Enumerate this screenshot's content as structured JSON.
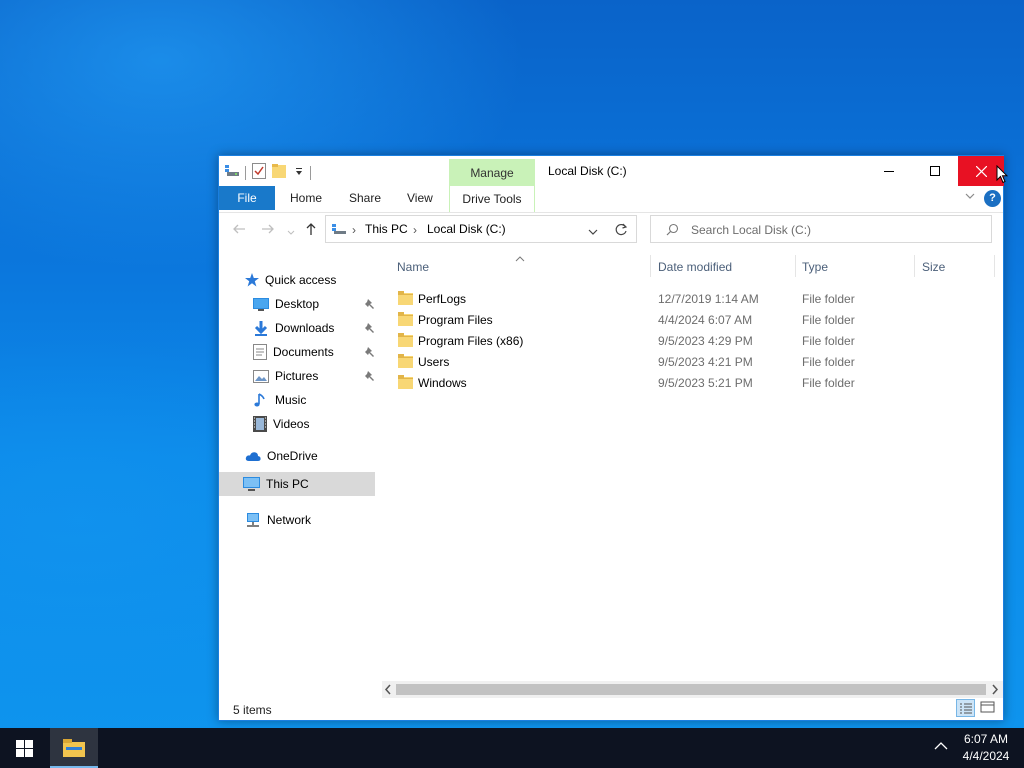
{
  "window": {
    "title": "Local Disk (C:)",
    "contextual_tab_group": "Manage",
    "contextual_tab": "Drive Tools"
  },
  "ribbon": {
    "tabs": [
      "File",
      "Home",
      "Share",
      "View"
    ]
  },
  "address": {
    "crumbs": [
      "This PC",
      "Local Disk (C:)"
    ]
  },
  "search": {
    "placeholder": "Search Local Disk (C:)"
  },
  "sidebar": {
    "quick_access": "Quick access",
    "pinned": [
      {
        "label": "Desktop",
        "icon": "desktop-icon",
        "pinned": true
      },
      {
        "label": "Downloads",
        "icon": "downloads-icon",
        "pinned": true
      },
      {
        "label": "Documents",
        "icon": "documents-icon",
        "pinned": true
      },
      {
        "label": "Pictures",
        "icon": "pictures-icon",
        "pinned": true
      },
      {
        "label": "Music",
        "icon": "music-icon",
        "pinned": false
      },
      {
        "label": "Videos",
        "icon": "videos-icon",
        "pinned": false
      }
    ],
    "onedrive": "OneDrive",
    "this_pc": "This PC",
    "network": "Network"
  },
  "columns": [
    "Name",
    "Date modified",
    "Type",
    "Size"
  ],
  "files": [
    {
      "name": "PerfLogs",
      "date": "12/7/2019 1:14 AM",
      "type": "File folder"
    },
    {
      "name": "Program Files",
      "date": "4/4/2024 6:07 AM",
      "type": "File folder"
    },
    {
      "name": "Program Files (x86)",
      "date": "9/5/2023 4:29 PM",
      "type": "File folder"
    },
    {
      "name": "Users",
      "date": "9/5/2023 4:21 PM",
      "type": "File folder"
    },
    {
      "name": "Windows",
      "date": "9/5/2023 5:21 PM",
      "type": "File folder"
    }
  ],
  "status": {
    "item_count": "5 items"
  },
  "taskbar": {
    "time": "6:07 AM",
    "date": "4/4/2024"
  },
  "colors": {
    "accent": "#1979ca",
    "close_red": "#e81123",
    "manage_green": "#c9f2b8"
  }
}
